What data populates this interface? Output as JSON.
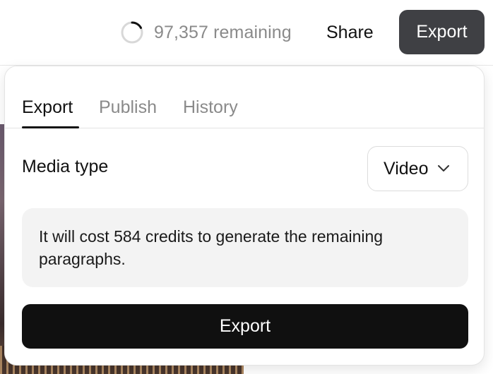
{
  "header": {
    "credits_text": "97,357 remaining",
    "share_label": "Share",
    "export_label": "Export"
  },
  "popover": {
    "tabs": [
      {
        "label": "Export",
        "active": true
      },
      {
        "label": "Publish",
        "active": false
      },
      {
        "label": "History",
        "active": false
      }
    ],
    "media_type_label": "Media type",
    "media_type_value": "Video",
    "cost_message": "It will cost 584 credits to generate the remaining paragraphs.",
    "export_button_label": "Export"
  },
  "icons": {
    "spinner": "loading-spinner-icon",
    "chevron": "chevron-down-icon"
  },
  "colors": {
    "primary_button": "#101010",
    "top_export_button": "#3f4044",
    "muted_text": "#8a8a8a",
    "info_box_bg": "#f3f3f3"
  }
}
